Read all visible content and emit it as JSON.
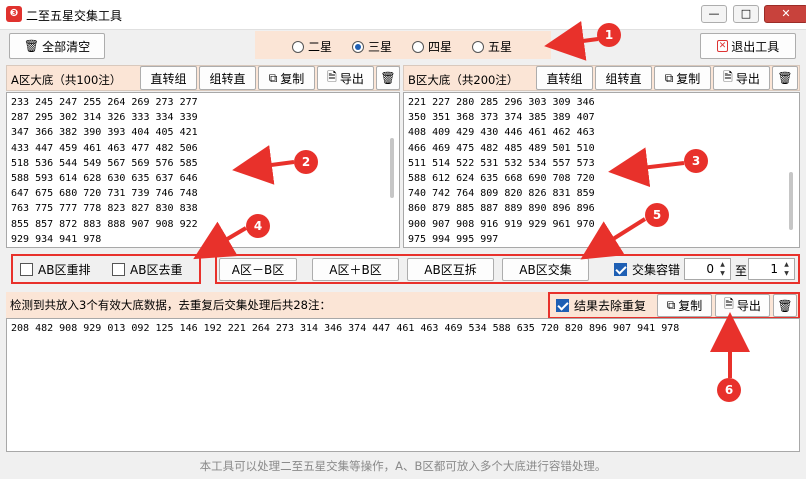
{
  "window": {
    "title": "二至五星交集工具",
    "min": "—",
    "max": "□",
    "close": "✕"
  },
  "toolbar": {
    "clear_all": "全部清空",
    "exit": "退出工具"
  },
  "star_options": [
    {
      "label": "二星",
      "selected": false
    },
    {
      "label": "三星",
      "selected": true
    },
    {
      "label": "四星",
      "selected": false
    },
    {
      "label": "五星",
      "selected": false
    }
  ],
  "pane_a": {
    "title": "A区大底（共100注）",
    "btn_to_group": "直转组",
    "btn_to_direct": "组转直",
    "btn_copy": "复制",
    "btn_export": "导出",
    "content": "233 245 247 255 264 269 273 277\n287 295 302 314 326 333 334 339\n347 366 382 390 393 404 405 421\n433 447 459 461 463 477 482 506\n518 536 544 549 567 569 576 585\n588 593 614 628 630 635 637 646\n647 675 680 720 731 739 746 748\n763 775 777 778 823 827 830 838\n855 857 872 883 888 907 908 922\n929 934 941 978"
  },
  "pane_b": {
    "title": "B区大底（共200注）",
    "btn_to_group": "直转组",
    "btn_to_direct": "组转直",
    "btn_copy": "复制",
    "btn_export": "导出",
    "content": "221 227 280 285 296 303 309 346\n350 351 368 373 374 385 389 407\n408 409 429 430 446 461 462 463\n466 469 475 482 485 489 501 510\n511 514 522 531 532 534 557 573\n588 612 624 635 668 690 708 720\n740 742 764 809 820 826 831 859\n860 879 885 887 889 890 896 896\n900 907 908 916 919 929 961 970\n975 994 995 997"
  },
  "options": {
    "ab_rearrange": "AB区重排",
    "ab_dedupe": "AB区去重"
  },
  "ops": {
    "a_minus_b": "A区－B区",
    "a_plus_b": "A区＋B区",
    "ab_mutual": "AB区互拆",
    "ab_intersect": "AB区交集"
  },
  "tolerance": {
    "label": "交集容错",
    "from": "0",
    "to_label": "至",
    "to": "1",
    "checked": true
  },
  "result": {
    "summary": "检测到共放入3个有效大底数据，去重复后交集处理后共28注：",
    "dedupe_label": "结果去除重复",
    "dedupe_checked": true,
    "copy": "复制",
    "export": "导出",
    "content": "208 482 908 929 013 092 125 146 192 221 264 273 314 346 374 447 461 463 469 534 588 635 720 820 896 907 941 978"
  },
  "status": "本工具可以处理二至五星交集等操作，A、B区都可放入多个大底进行容错处理。",
  "annotations": [
    "1",
    "2",
    "3",
    "4",
    "5",
    "6"
  ],
  "colors": {
    "accent_red": "#e8312b",
    "panel_peach": "#fbe5d6",
    "check_blue": "#1e5fb4"
  }
}
